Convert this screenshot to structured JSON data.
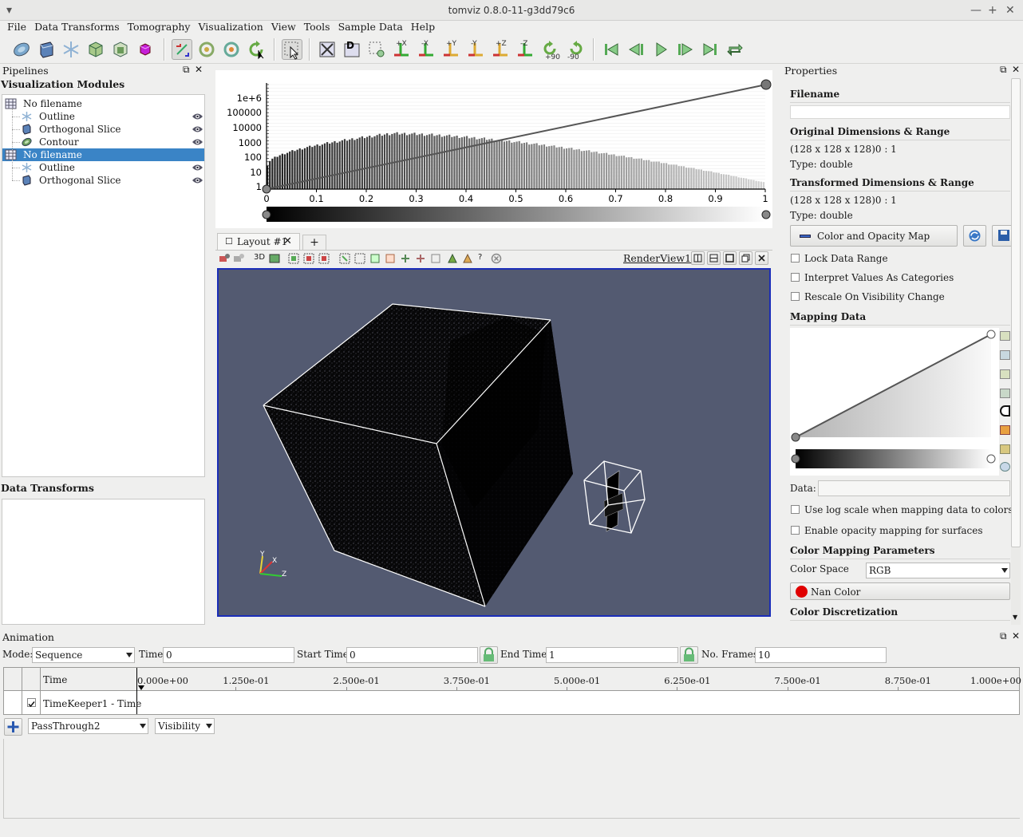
{
  "window": {
    "title": "tomviz 0.8.0-11-g3dd79c6"
  },
  "menu": [
    "File",
    "Data Transforms",
    "Tomography",
    "Visualization",
    "View",
    "Tools",
    "Sample Data",
    "Help"
  ],
  "toolbar": {
    "rotate_plus_label": "+90",
    "rotate_minus_label": "-90",
    "axis_labels": [
      "+X",
      "-X",
      "+Y",
      "-Y",
      "+Z",
      "-Z"
    ]
  },
  "pipelines": {
    "header": "Pipelines",
    "subheader": "Visualization Modules",
    "items": [
      {
        "label": "No filename",
        "level": 0,
        "selected": false,
        "eye": false,
        "icon": "dataset-icon"
      },
      {
        "label": "Outline",
        "level": 1,
        "selected": false,
        "eye": true,
        "icon": "outline-icon"
      },
      {
        "label": "Orthogonal Slice",
        "level": 1,
        "selected": false,
        "eye": true,
        "icon": "slice-icon"
      },
      {
        "label": "Contour",
        "level": 1,
        "selected": false,
        "eye": true,
        "icon": "contour-icon"
      },
      {
        "label": "No filename",
        "level": 0,
        "selected": true,
        "eye": false,
        "icon": "dataset-icon"
      },
      {
        "label": "Outline",
        "level": 1,
        "selected": false,
        "eye": true,
        "icon": "outline-icon"
      },
      {
        "label": "Orthogonal Slice",
        "level": 1,
        "selected": false,
        "eye": true,
        "icon": "slice-icon"
      }
    ]
  },
  "data_transforms": {
    "header": "Data Transforms"
  },
  "histogram": {
    "y_ticks": [
      "1e+6",
      "100000",
      "10000",
      "1000",
      "100",
      "10",
      "1"
    ],
    "x_ticks": [
      "0",
      "0.1",
      "0.2",
      "0.3",
      "0.4",
      "0.5",
      "0.6",
      "0.7",
      "0.8",
      "0.9",
      "1"
    ]
  },
  "layout_tab": {
    "label": "Layout #1",
    "add_label": "+"
  },
  "render_toolbar": {
    "view_3d_label": "3D",
    "query_label": "?",
    "view_name": "RenderView1"
  },
  "axes_widget": {
    "y": "Y",
    "x": "X",
    "z": "Z"
  },
  "properties": {
    "header": "Properties",
    "filename_label": "Filename",
    "filename_value": "",
    "original_header": "Original Dimensions & Range",
    "original_dims": "(128 x 128 x 128)0 : 1",
    "original_type": "Type: double",
    "transformed_header": "Transformed Dimensions & Range",
    "transformed_dims": "(128 x 128 x 128)0 : 1",
    "transformed_type": "Type: double",
    "color_map_button": "Color and Opacity Map",
    "lock_range": "Lock Data Range",
    "interpret_categories": "Interpret Values As Categories",
    "rescale_visibility": "Rescale On Visibility Change",
    "mapping_header": "Mapping Data",
    "data_label": "Data:",
    "data_value": "",
    "log_scale": "Use log scale when mapping data to colors",
    "opacity_surfaces": "Enable opacity mapping for surfaces",
    "color_params_header": "Color Mapping Parameters",
    "color_space_label": "Color Space",
    "color_space_value": "RGB",
    "nan_color_label": "Nan Color",
    "nan_color": "#e00000",
    "discretization_header": "Color Discretization"
  },
  "animation": {
    "header": "Animation",
    "mode_label": "Mode:",
    "mode_value": "Sequence",
    "time_label": "Time",
    "time_value": "0",
    "start_label": "Start Time:",
    "start_value": "0",
    "end_label": "End Time:",
    "end_value": "1",
    "frames_label": "No. Frames:",
    "frames_value": "10",
    "time_col": "Time",
    "ticks": [
      "0.000e+00",
      "1.250e-01",
      "2.500e-01",
      "3.750e-01",
      "5.000e-01",
      "6.250e-01",
      "7.500e-01",
      "8.750e-01",
      "1.000e+00"
    ],
    "track_label": "TimeKeeper1 - Time",
    "source_value": "PassThrough2",
    "property_value": "Visibility"
  },
  "colors": {
    "accent": "#3a84c6",
    "render_bg": "#535a71",
    "selection_border": "#1a2db8"
  }
}
